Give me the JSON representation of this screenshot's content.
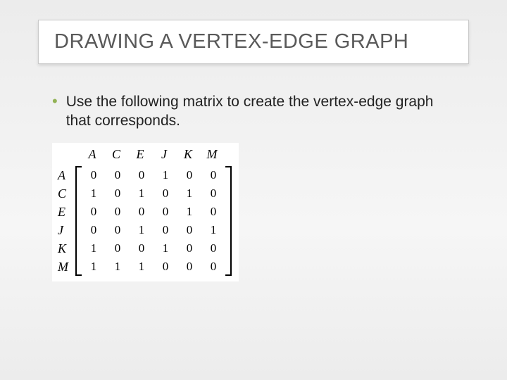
{
  "title": "DRAWING A VERTEX-EDGE GRAPH",
  "bullet": "Use the following matrix to create the vertex-edge graph that corresponds.",
  "matrix": {
    "cols": [
      "A",
      "C",
      "E",
      "J",
      "K",
      "M"
    ],
    "rows": [
      "A",
      "C",
      "E",
      "J",
      "K",
      "M"
    ],
    "values": [
      [
        0,
        0,
        0,
        1,
        0,
        0
      ],
      [
        1,
        0,
        1,
        0,
        1,
        0
      ],
      [
        0,
        0,
        0,
        0,
        1,
        0
      ],
      [
        0,
        0,
        1,
        0,
        0,
        1
      ],
      [
        1,
        0,
        0,
        1,
        0,
        0
      ],
      [
        1,
        1,
        1,
        0,
        0,
        0
      ]
    ]
  }
}
